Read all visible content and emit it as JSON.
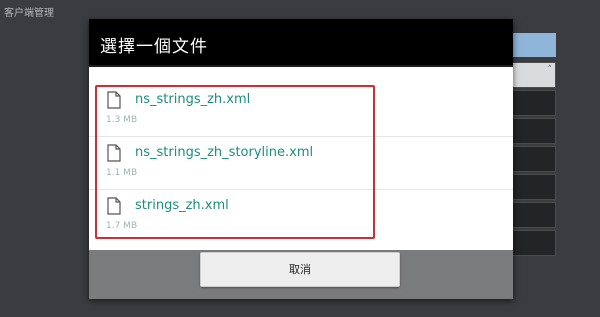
{
  "app": {
    "title": "客户端管理"
  },
  "dialog": {
    "title": "選擇一個文件",
    "cancel_label": "取消",
    "files": [
      {
        "name": "ns_strings_zh.xml",
        "size": "1.3 MB"
      },
      {
        "name": "ns_strings_zh_storyline.xml",
        "size": "1.1 MB"
      },
      {
        "name": "strings_zh.xml",
        "size": "1.7 MB"
      }
    ]
  },
  "colors": {
    "file_name": "#18907c",
    "file_size": "#9db7b3",
    "highlight": "#e0262f",
    "header": "#000000"
  },
  "icons": {
    "file": "document-icon"
  }
}
